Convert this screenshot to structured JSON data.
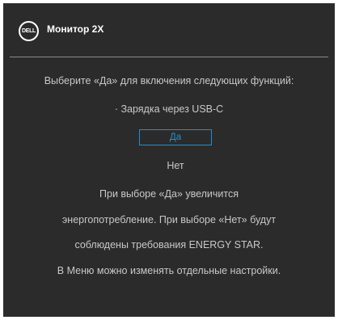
{
  "header": {
    "logo_text": "DELL",
    "title": "Монитор 2X"
  },
  "dialog": {
    "prompt": "Выберите «Да» для включения следующих функций:",
    "feature": "· Зарядка через USB-C",
    "options": {
      "yes": "Да",
      "no": "Нет",
      "selected": "yes"
    },
    "info_lines": [
      "При выборе «Да» увеличится",
      "энергопотребление. При выборе «Нет» будут",
      "соблюдены требования ENERGY STAR.",
      "В Меню можно изменять отдельные настройки."
    ]
  },
  "colors": {
    "background": "#2b2b2b",
    "text": "#c8c8c8",
    "accent": "#1e8fd8",
    "title": "#ffffff"
  }
}
